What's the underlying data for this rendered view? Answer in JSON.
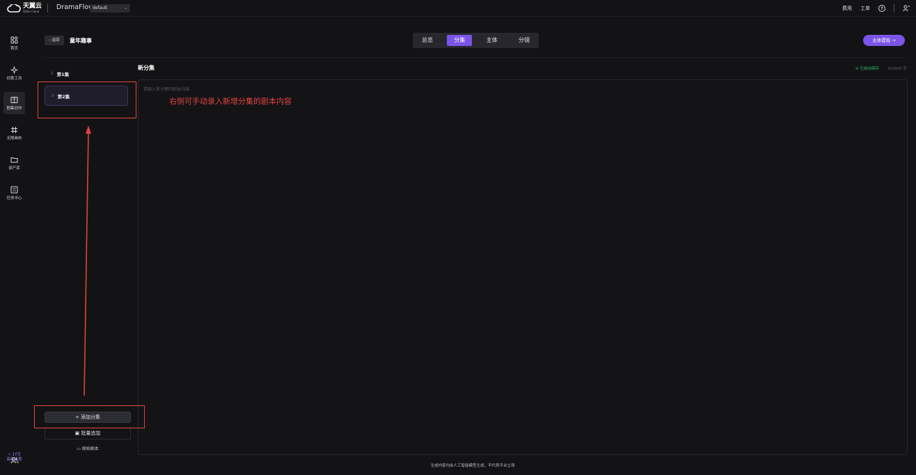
{
  "topbar": {
    "logo_text": "天翼云",
    "logo_sub": "State Cloud",
    "app_name": "DramaFlow",
    "workspace": "default",
    "right_links": [
      "费用",
      "工单"
    ],
    "help_icon": "question-circle-icon",
    "user_icon": "user-switch-icon"
  },
  "nav": {
    "items": [
      {
        "label": "首页",
        "icon": "grid-icon"
      },
      {
        "label": "创意工坊",
        "icon": "sparkle-icon"
      },
      {
        "label": "剧集创作",
        "icon": "book-icon"
      },
      {
        "label": "无限画布",
        "icon": "hash-icon"
      },
      {
        "label": "资产库",
        "icon": "folder-icon"
      },
      {
        "label": "任务中心",
        "icon": "task-icon"
      }
    ],
    "active_index": 2,
    "member_count": "✧ 17万",
    "member_label": "高级会员"
  },
  "header": {
    "back_label": "‹ 返回",
    "title": "童年趣事",
    "tabs": [
      "总览",
      "分集",
      "主体",
      "分镜"
    ],
    "active_tab": 1,
    "extract_label": "主体提取 →"
  },
  "episodes": {
    "items": [
      "第1集",
      "第2集"
    ],
    "selected_index": 1,
    "add_label": "+ 添加分集",
    "batch_label": "批量追加",
    "raw_label": "原始剧本"
  },
  "editor": {
    "title": "新分集",
    "autosave": "已自动保存",
    "char_count": "0/3000 字",
    "placeholder": "请输入新分集的剧本内容..."
  },
  "annotation": {
    "text": "右侧可手动录入新增分集的剧本内容",
    "color": "#e0443e"
  },
  "footer": {
    "note": "生成内容均由人工智能模型生成，不代表平台立场"
  },
  "colors": {
    "accent": "#7b55e8",
    "success": "#2fbf71",
    "background": "#131316"
  }
}
